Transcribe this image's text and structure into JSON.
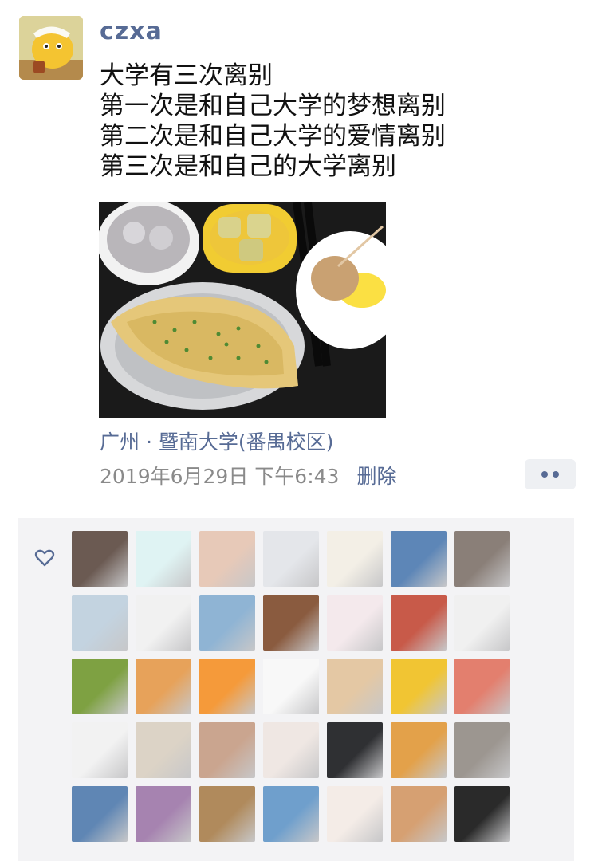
{
  "post": {
    "username": "czxa",
    "lines": [
      "大学有三次离别",
      "第一次是和自己大学的梦想离别",
      "第二次是和自己大学的爱情离别",
      "第三次是和自己的大学离别"
    ],
    "location": "广州 · 暨南大学(番禺校区)",
    "timestamp": "2019年6月29日 下午6:43",
    "delete_label": "删除"
  },
  "colors": {
    "link": "#576b95",
    "panel": "#f3f3f5",
    "meta": "#8a8a8a"
  },
  "likes": {
    "icon": "heart-outline-icon",
    "avatars": [
      "#6b5a52",
      "#dff3f3",
      "#e7c9b8",
      "#e4e6ea",
      "#f3efe6",
      "#5d86b7",
      "#8a7f78",
      "#c3d3e0",
      "#f1f1f1",
      "#8fb4d4",
      "#8a5b3f",
      "#f4e9ec",
      "#c85a49",
      "#f0f0f0",
      "#7ea142",
      "#e7a25a",
      "#f59a3a",
      "#f8f8f8",
      "#e4c8a4",
      "#f1c533",
      "#e37f6e",
      "#f2f2f2",
      "#dcd3c6",
      "#caa58f",
      "#efe7e3",
      "#2f3033",
      "#e3a14a",
      "#9c9690",
      "#5f86b4",
      "#a683b0",
      "#b08a5c",
      "#6f9fcc",
      "#f4ece7",
      "#d6a072",
      "#2a2a2a"
    ]
  }
}
